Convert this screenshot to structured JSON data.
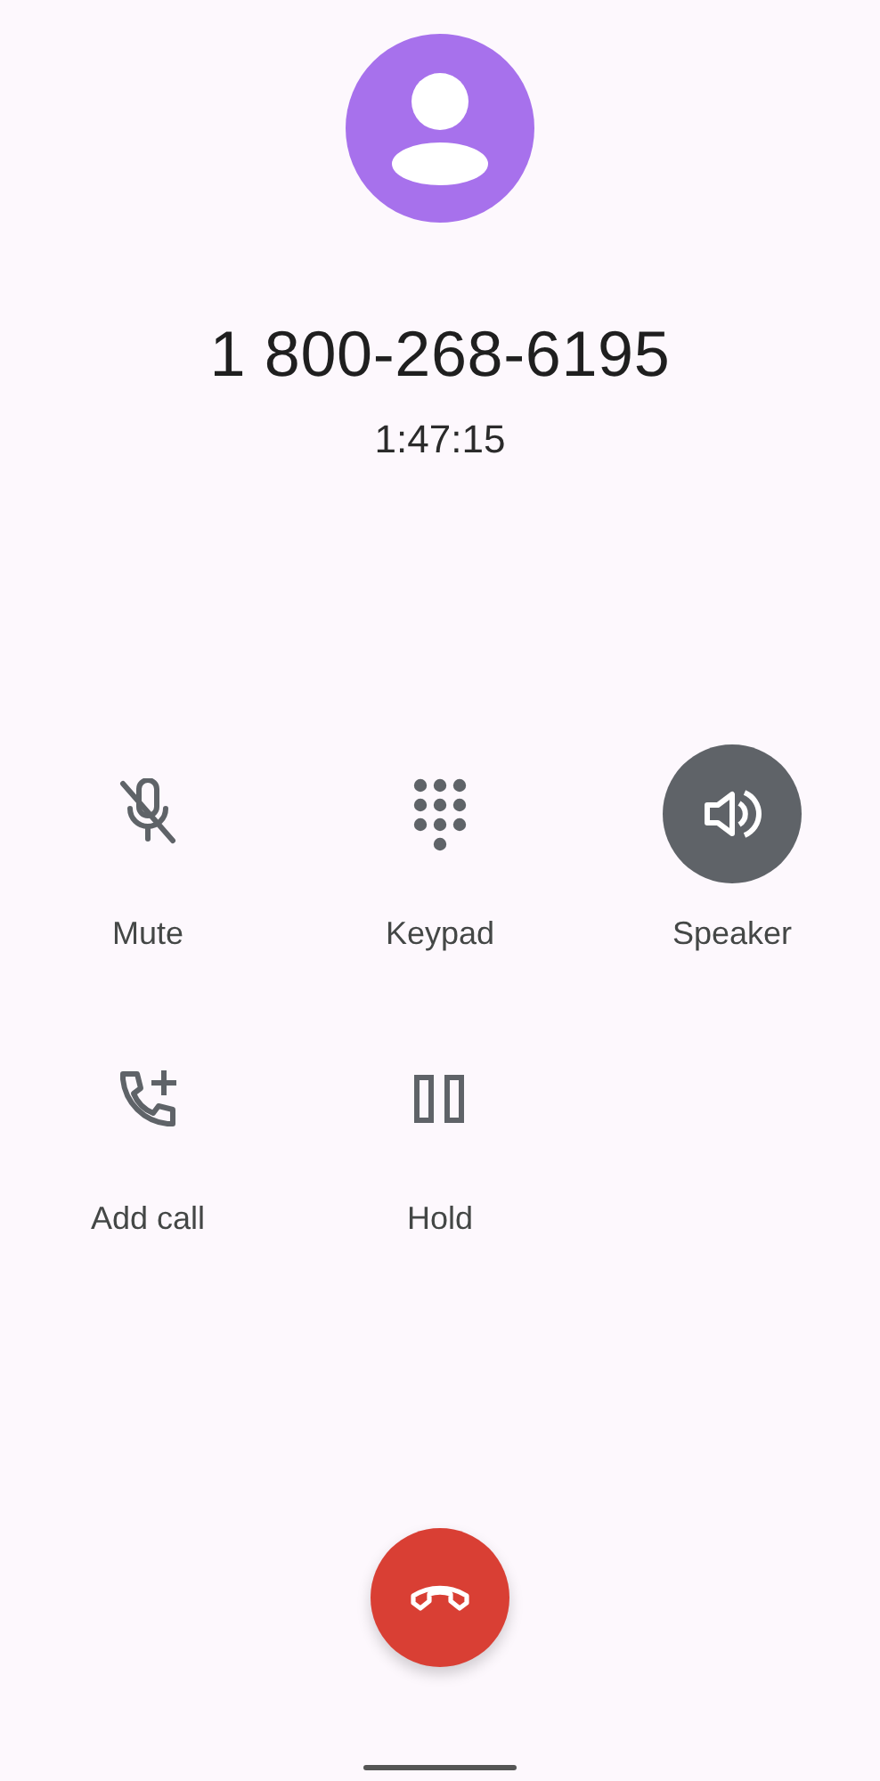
{
  "caller": {
    "number": "1 800-268-6195",
    "duration": "1:47:15"
  },
  "controls": [
    {
      "kind": "mute",
      "label": "Mute",
      "on": false
    },
    {
      "kind": "keypad",
      "label": "Keypad",
      "on": false
    },
    {
      "kind": "speaker",
      "label": "Speaker",
      "on": true
    },
    {
      "kind": "add_call",
      "label": "Add call",
      "on": false
    },
    {
      "kind": "hold",
      "label": "Hold",
      "on": false
    }
  ]
}
